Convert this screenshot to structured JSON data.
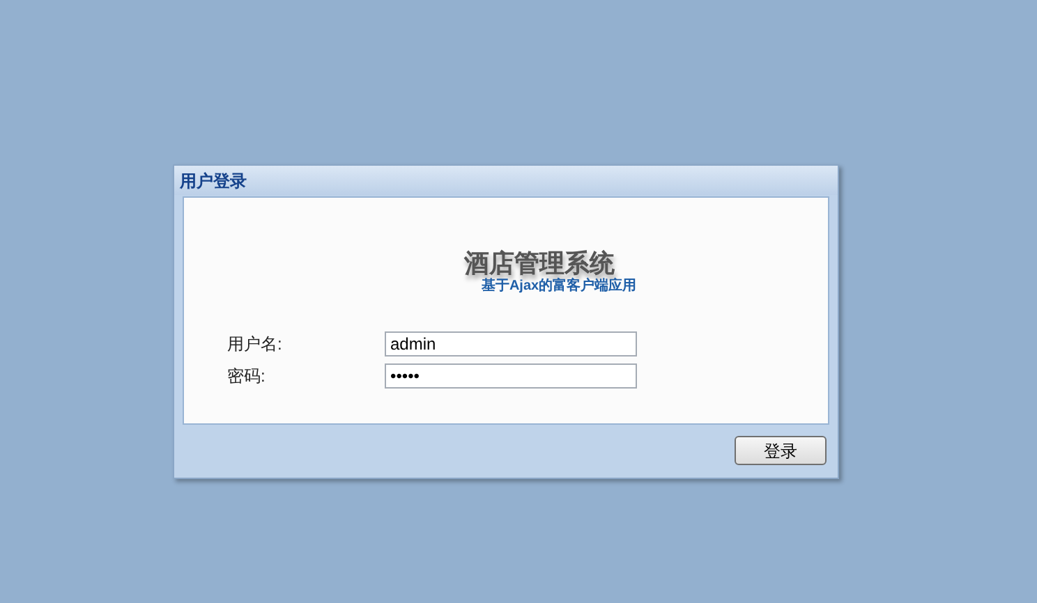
{
  "dialog": {
    "title": "用户登录"
  },
  "logo": {
    "title": "酒店管理系统",
    "subtitle": "基于Ajax的富客户端应用"
  },
  "fields": [
    {
      "label": "用户名:",
      "value": "admin"
    },
    {
      "label": "密码:",
      "value": "•••••"
    }
  ],
  "buttons": [
    "登录"
  ]
}
